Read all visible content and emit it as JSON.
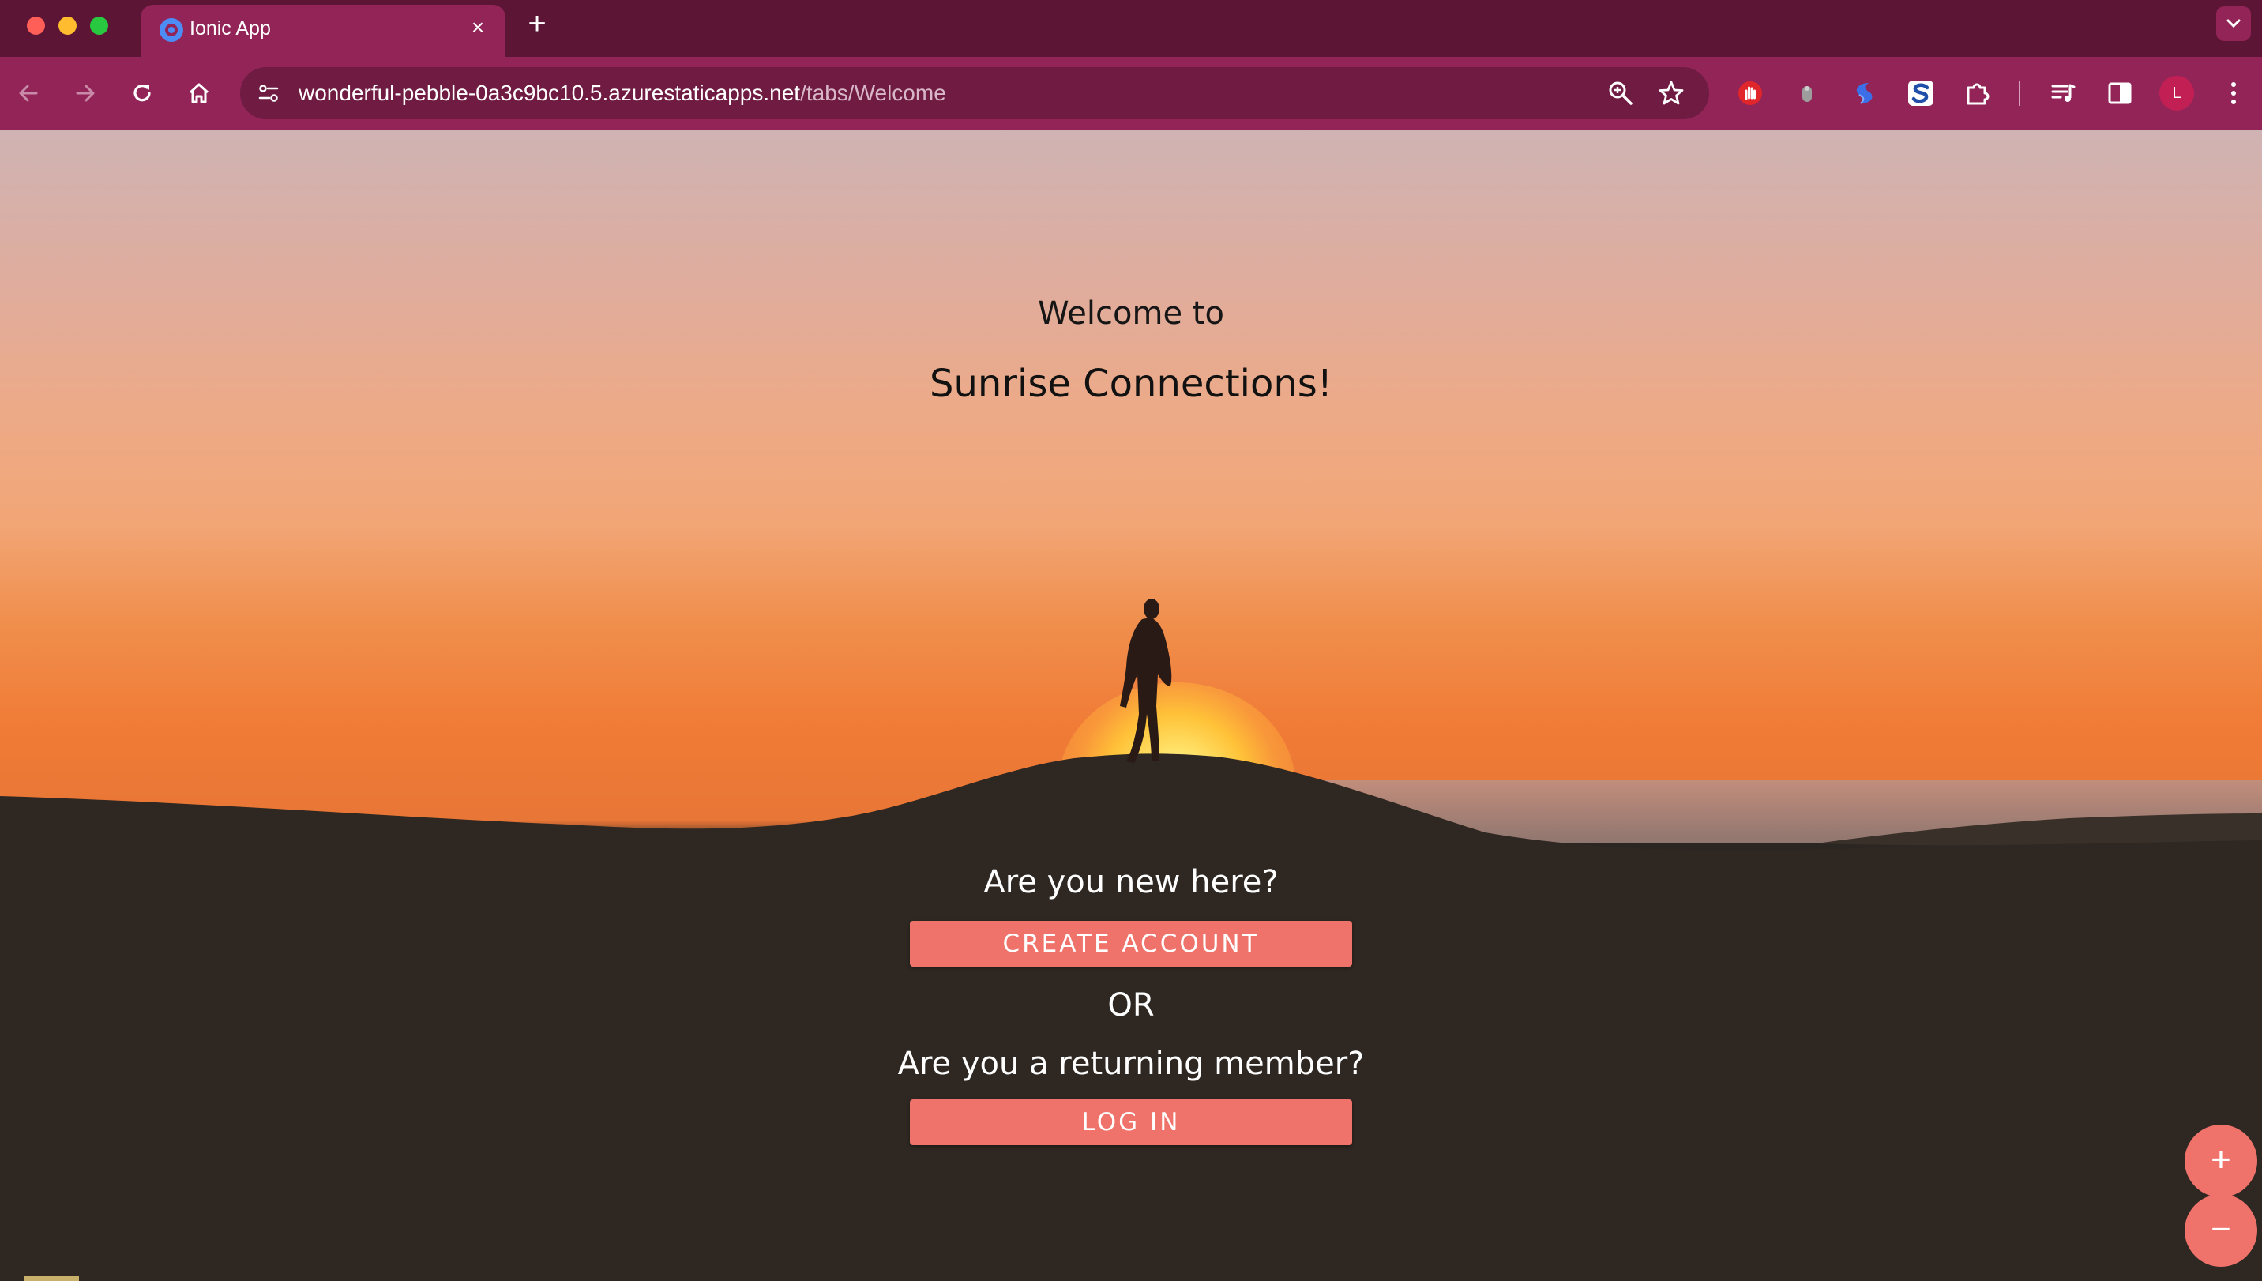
{
  "browser": {
    "tab_title": "Ionic App",
    "close_tab_symbol": "×",
    "new_tab_symbol": "+",
    "url_host": "wonderful-pebble-0a3c9bc10.5.azurestaticapps.net",
    "url_path": "/tabs/Welcome",
    "profile_initial": "L",
    "icons": [
      "back-icon",
      "forward-icon",
      "reload-icon",
      "home-icon",
      "site-info-icon",
      "zoom-icon",
      "bookmark-star-icon",
      "adblock-icon",
      "extension-gray-icon",
      "extension-blue-icon",
      "extension-s-icon",
      "puzzle-icon",
      "reading-list-icon",
      "side-panel-icon",
      "kebab-menu-icon"
    ],
    "colors": {
      "frame": "#5c1535",
      "toolbar": "#922457",
      "omnibox": "#6f1b42"
    }
  },
  "page": {
    "welcome_line": "Welcome to",
    "app_name": "Sunrise Connections!",
    "new_prompt": "Are you new here?",
    "create_label": "CREATE ACCOUNT",
    "or_label": "OR",
    "returning_prompt": "Are you a returning member?",
    "login_label": "LOG IN",
    "zoom_in_symbol": "+",
    "zoom_out_symbol": "−",
    "colors": {
      "button": "#ef736b",
      "heading_text": "#111111",
      "prompt_text": "#ffffff"
    }
  }
}
